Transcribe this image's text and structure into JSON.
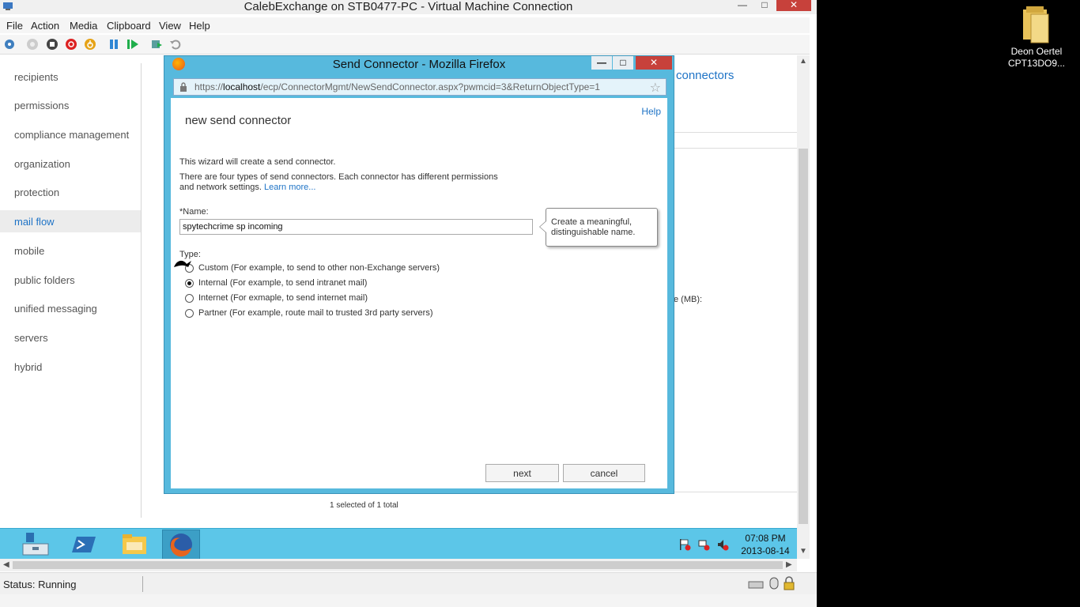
{
  "vm": {
    "title": "CalebExchange on STB0477-PC - Virtual Machine Connection",
    "menu": [
      "File",
      "Action",
      "Media",
      "Clipboard",
      "View",
      "Help"
    ],
    "status": "Status: Running"
  },
  "sidebar": {
    "items": [
      {
        "label": "recipients"
      },
      {
        "label": "permissions"
      },
      {
        "label": "compliance management"
      },
      {
        "label": "organization"
      },
      {
        "label": "protection"
      },
      {
        "label": "mail flow"
      },
      {
        "label": "mobile"
      },
      {
        "label": "public folders"
      },
      {
        "label": "unified messaging"
      },
      {
        "label": "servers"
      },
      {
        "label": "hybrid"
      }
    ],
    "selected": "mail flow"
  },
  "background": {
    "link": "connectors",
    "field_fragment": "e (MB):",
    "selection_count": "1 selected of 1 total"
  },
  "firefox": {
    "title": "Send Connector - Mozilla Firefox",
    "url_prefix": "https://",
    "url_host": "localhost",
    "url_path": "/ecp/ConnectorMgmt/NewSendConnector.aspx?pwmcid=3&ReturnObjectType=1"
  },
  "dialog": {
    "help": "Help",
    "heading": "new send connector",
    "intro": "This wizard will create a send connector.",
    "desc_line1": "There are four types of send connectors. Each connector has different permissions",
    "desc_line2": "and network settings.",
    "learn_more": "Learn more...",
    "name_label": "*Name:",
    "name_value": "spytechcrime sp incoming",
    "tooltip_line1": "Create a meaningful,",
    "tooltip_line2": "distinguishable name.",
    "type_label": "Type:",
    "types": [
      {
        "label": "Custom (For example, to send to other non-Exchange servers)",
        "checked": false
      },
      {
        "label": "Internal (For example, to send intranet mail)",
        "checked": true
      },
      {
        "label": "Internet (For exmaple, to send internet mail)",
        "checked": false
      },
      {
        "label": "Partner (For example, route mail to trusted 3rd party servers)",
        "checked": false
      }
    ],
    "next": "next",
    "cancel": "cancel"
  },
  "taskbar": {
    "time": "07:08 PM",
    "date": "2013-08-14"
  },
  "desktop": {
    "icon_label_line1": "Deon Oertel",
    "icon_label_line2": "CPT13DO9..."
  },
  "colors": {
    "accent": "#1e73c6",
    "dialog_frame": "#57b9dd",
    "taskbar": "#5cc6e8",
    "close_red": "#c7413b"
  }
}
